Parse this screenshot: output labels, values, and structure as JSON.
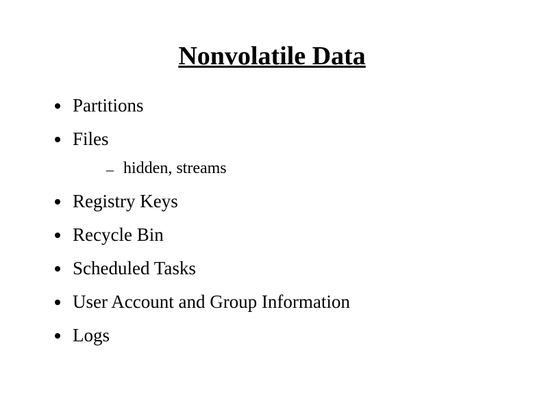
{
  "title": "Nonvolatile Data",
  "items": [
    {
      "text": "Partitions"
    },
    {
      "text": "Files",
      "subitems": [
        {
          "text": "hidden, streams"
        }
      ]
    },
    {
      "text": "Registry Keys"
    },
    {
      "text": "Recycle Bin"
    },
    {
      "text": "Scheduled Tasks"
    },
    {
      "text": "User Account and Group Information"
    },
    {
      "text": "Logs"
    }
  ]
}
